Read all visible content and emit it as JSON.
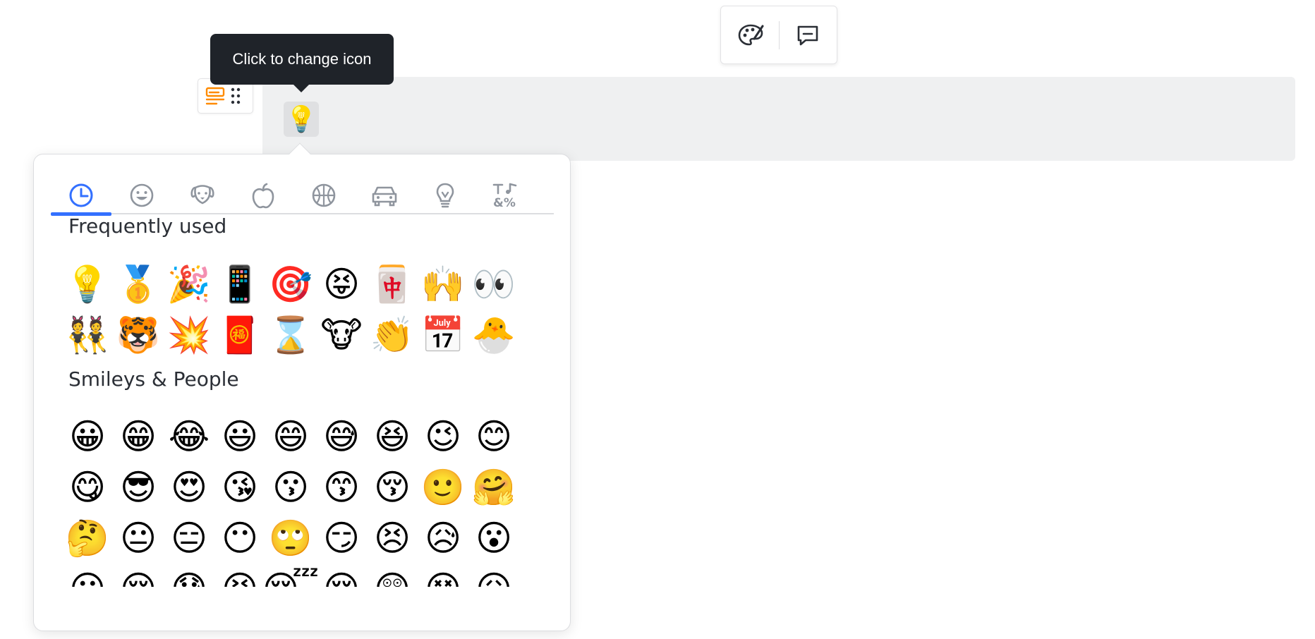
{
  "tooltip": {
    "text": "Click to change icon"
  },
  "callout": {
    "icon": "💡"
  },
  "icons": {
    "toolbar_palette": "palette-icon",
    "toolbar_comment": "comment-icon",
    "block_type": "callout-block-icon",
    "drag_handle": "drag-handle-icon"
  },
  "colors": {
    "accent": "#3370ff",
    "tooltip_bg": "#1f2329",
    "block_icon": "#ff8a00",
    "callout_bg": "#eff0f1"
  },
  "picker": {
    "tabs": [
      {
        "name": "recent-tab",
        "icon": "clock-icon"
      },
      {
        "name": "smileys-tab",
        "icon": "smiley-icon"
      },
      {
        "name": "animals-tab",
        "icon": "dog-icon"
      },
      {
        "name": "food-tab",
        "icon": "apple-icon"
      },
      {
        "name": "activities-tab",
        "icon": "basketball-icon"
      },
      {
        "name": "travel-tab",
        "icon": "car-icon"
      },
      {
        "name": "objects-tab",
        "icon": "lightbulb-icon"
      },
      {
        "name": "symbols-tab",
        "icon": "symbols-icon"
      }
    ],
    "active_tab": 0,
    "sections": [
      {
        "title": "Frequently used",
        "emojis": [
          "💡",
          "🥇",
          "🎉",
          "📱",
          "🎯",
          "😝",
          "🀄",
          "🙌",
          "👀",
          "👯",
          "🐯",
          "💥",
          "🧧",
          "⌛",
          "🐮",
          "👏",
          "📅",
          "🐣"
        ]
      },
      {
        "title": "Smileys & People",
        "emojis": [
          "😀",
          "😁",
          "😂",
          "😃",
          "😄",
          "😅",
          "😆",
          "😉",
          "😊",
          "😋",
          "😎",
          "😍",
          "😘",
          "😗",
          "😙",
          "😚",
          "🙂",
          "🤗",
          "🤔",
          "😐",
          "😑",
          "😶",
          "🙄",
          "😏",
          "😣",
          "😥",
          "😮",
          "😐",
          "😌",
          "😓",
          "😫",
          "😴",
          "😔",
          "😲",
          "😵",
          "😖"
        ]
      }
    ]
  }
}
